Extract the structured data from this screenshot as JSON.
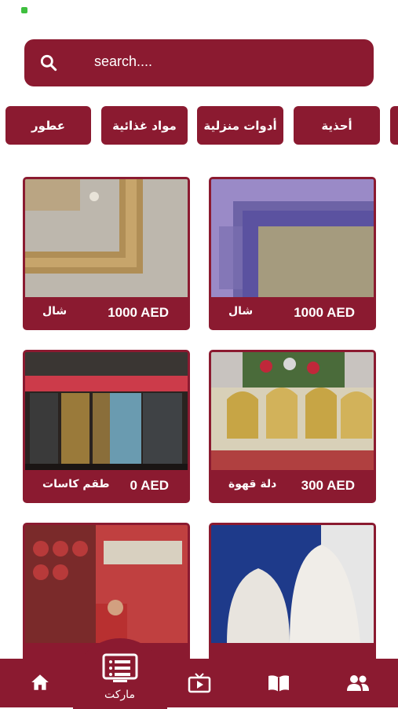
{
  "search": {
    "placeholder": "search...."
  },
  "categories": [
    {
      "label": "عطور"
    },
    {
      "label": "مواد غذائية"
    },
    {
      "label": "أدوات منزلية"
    },
    {
      "label": "أحذية"
    }
  ],
  "products": [
    {
      "name": "شال",
      "price": "1000 AED",
      "image": "embroidered-shawl-beige"
    },
    {
      "name": "شال",
      "price": "1000 AED",
      "image": "embroidered-shawl-purple"
    },
    {
      "name": "طقم كاسات",
      "price": "0 AED",
      "image": "glass-sets-shelves"
    },
    {
      "name": "دلة قهوة",
      "price": "300 AED",
      "image": "coffee-pots-display"
    },
    {
      "name": "",
      "price": "",
      "image": "red-cookware-shop"
    },
    {
      "name": "",
      "price": "",
      "image": "white-crochet-caps"
    }
  ],
  "bottom_nav": {
    "items": [
      {
        "icon": "home-icon"
      },
      {
        "icon": "market-list-icon",
        "label": "ماركت"
      },
      {
        "icon": "tv-icon"
      },
      {
        "icon": "book-icon"
      },
      {
        "icon": "people-icon"
      }
    ]
  },
  "colors": {
    "primary": "#8b1a30",
    "background": "#ffffff",
    "text_on_primary": "#ffffff"
  }
}
